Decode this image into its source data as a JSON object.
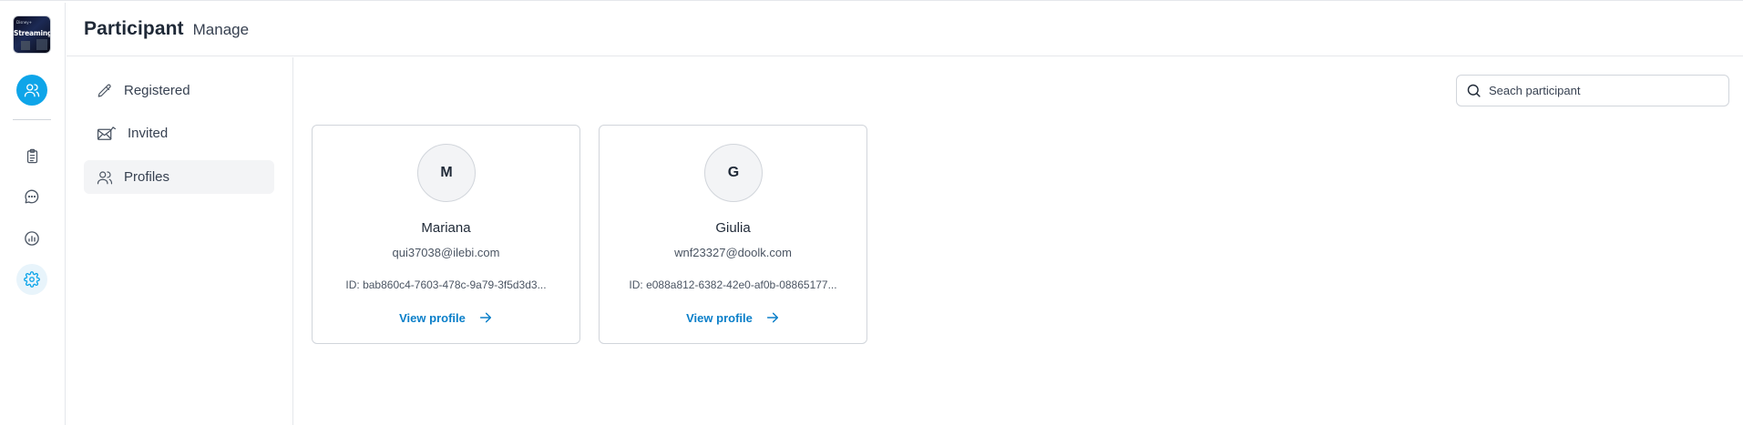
{
  "app": {
    "logo_top_text": "Disney+",
    "logo_text": "Streaming"
  },
  "rail": {
    "items": [
      {
        "icon": "users-icon",
        "active": true
      },
      {
        "icon": "clipboard-icon",
        "active": false
      },
      {
        "icon": "chat-icon",
        "active": false
      },
      {
        "icon": "chart-icon",
        "active": false
      },
      {
        "icon": "settings-icon",
        "active": false
      }
    ]
  },
  "header": {
    "title": "Participant",
    "subtitle": "Manage"
  },
  "submenu": {
    "items": [
      {
        "label": "Registered",
        "icon": "pencil-icon"
      },
      {
        "label": "Invited",
        "icon": "mail-icon"
      },
      {
        "label": "Profiles",
        "icon": "users-icon",
        "active": true
      }
    ]
  },
  "search": {
    "placeholder": "Seach participant",
    "value": ""
  },
  "profiles": [
    {
      "initial": "M",
      "name": "Mariana",
      "email": "qui37038@ilebi.com",
      "id_text": "ID: bab860c4-7603-478c-9a79-3f5d3d3...",
      "link_label": "View profile"
    },
    {
      "initial": "G",
      "name": "Giulia",
      "email": "wnf23327@doolk.com",
      "id_text": "ID: e088a812-6382-42e0-af0b-08865177...",
      "link_label": "View profile"
    }
  ],
  "colors": {
    "accent": "#0ea5e9",
    "link": "#0b7fc9",
    "border": "#d1d5db"
  }
}
